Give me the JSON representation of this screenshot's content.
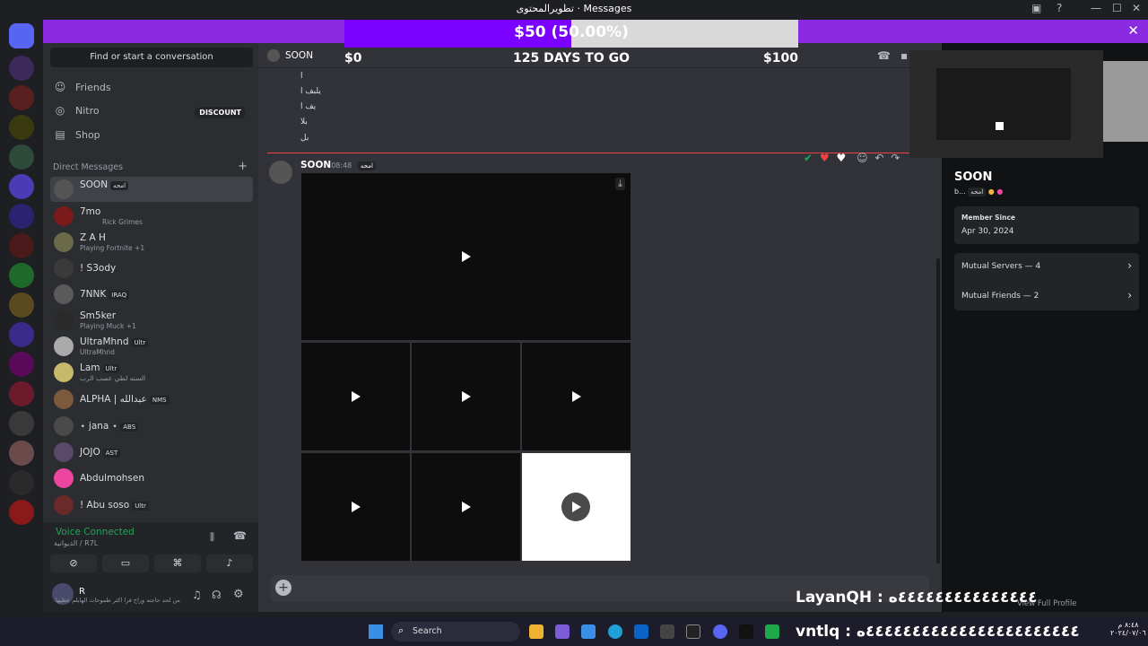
{
  "window": {
    "title": "تطويرالمحتوى · Messages"
  },
  "goal": {
    "current": "$50 (50.00%)",
    "start": "$0",
    "days_left": "125 DAYS TO GO",
    "target": "$100",
    "progress_fraction": 0.5
  },
  "sidebar": {
    "search_placeholder": "Find or start a conversation",
    "nav": [
      {
        "label": "Friends"
      },
      {
        "label": "Nitro"
      },
      {
        "label": "Shop"
      }
    ],
    "nitro_badge": "DISCOUNT",
    "dm_header": "Direct Messages",
    "dms": [
      {
        "name": "SOON",
        "tag": "امحه",
        "sub": ""
      },
      {
        "name": "7mo",
        "tag": "",
        "sub": "Rick Grimes"
      },
      {
        "name": "Z A H",
        "tag": "",
        "sub": "Playing Fortnite +1"
      },
      {
        "name": "! S3ody",
        "tag": "",
        "sub": ""
      },
      {
        "name": "7NNK",
        "tag": "IRAQ",
        "sub": ""
      },
      {
        "name": "Sm5ker",
        "tag": "",
        "sub": "Playing Muck +1"
      },
      {
        "name": "UltraMhnd",
        "tag": "Ultr",
        "sub": "UltraMhnd"
      },
      {
        "name": "Lam",
        "tag": "Ultr",
        "sub": "السنه لطي عصب الرب"
      },
      {
        "name": "ALPHA | عبدالله",
        "tag": "NMS",
        "sub": ""
      },
      {
        "name": "⋆ jana ⋆",
        "tag": "ABS",
        "sub": ""
      },
      {
        "name": "JOJO",
        "tag": "AST",
        "sub": ""
      },
      {
        "name": "Abdulmohsen",
        "tag": "",
        "sub": ""
      },
      {
        "name": "! Abu soso",
        "tag": "Ultr",
        "sub": ""
      }
    ],
    "voice": {
      "status": "Voice Connected",
      "channel": "الديوانية / R7L"
    },
    "user": {
      "name": "R",
      "status": "من لحد حاجته وراح فرا اكثر طموحات الهايلم عطيها"
    }
  },
  "chat": {
    "channel_name": "SOON",
    "prev_lines": [
      "ا",
      "يلبف ا",
      "يف ا",
      "بلا",
      "بل"
    ],
    "author": "SOON",
    "author_tag": "امحه",
    "time": "08:48",
    "videos": 9
  },
  "profile": {
    "name": "SOON",
    "handle": "b...",
    "tag": "امحه",
    "member_since_label": "Member Since",
    "member_since": "Apr 30, 2024",
    "mutual_servers": "Mutual Servers — 4",
    "mutual_friends": "Mutual Friends — 2",
    "view_full": "View Full Profile"
  },
  "overlay": {
    "line1": "LayanQH : ٤٤٤٤٤٤٤٤٤٤٤٤٤٤٤ه",
    "line2": "vntlq : ٤٤٤٤٤٤٤٤٤٤٤٤٤٤٤٤٤٤٤٤٤٤٤ه"
  },
  "taskbar": {
    "search_label": "Search",
    "clock_time": "٨:٤٨ م",
    "clock_date": "٢٠٢٤/٠٧/٠٦"
  },
  "colors": {
    "banner": "#8a2be2",
    "goal_fill": "#7a00ff",
    "online": "#23a55a",
    "dnd": "#f23f43"
  }
}
